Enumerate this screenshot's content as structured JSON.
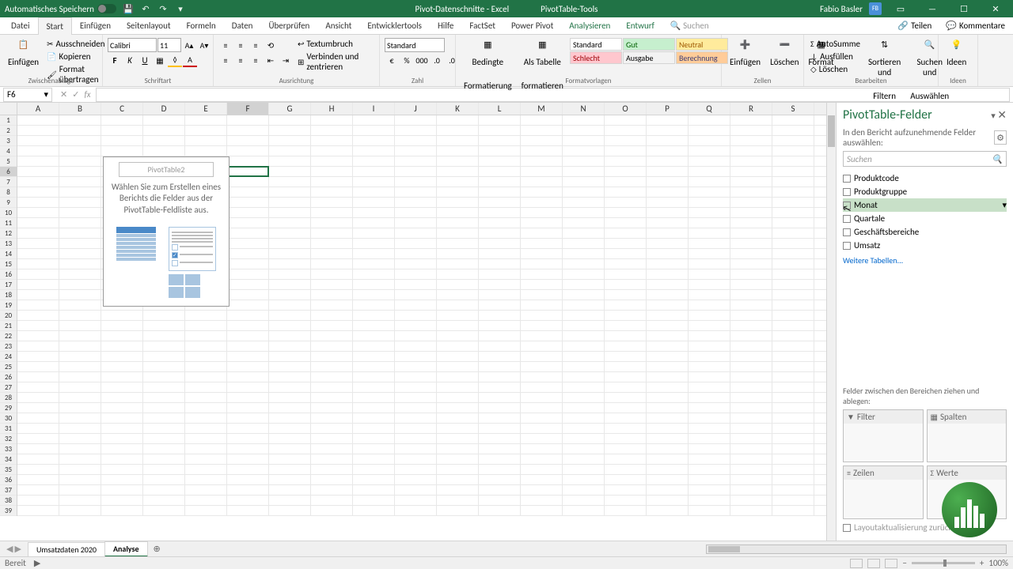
{
  "titlebar": {
    "autosave": "Automatisches Speichern",
    "doc_title": "Pivot-Datenschnitte - Excel",
    "tools": "PivotTable-Tools",
    "user": "Fabio Basler",
    "user_initials": "FB"
  },
  "tabs": {
    "datei": "Datei",
    "start": "Start",
    "einf": "Einfügen",
    "seiten": "Seitenlayout",
    "formeln": "Formeln",
    "daten": "Daten",
    "ueber": "Überprüfen",
    "ansicht": "Ansicht",
    "entw": "Entwicklertools",
    "hilfe": "Hilfe",
    "factset": "FactSet",
    "pp": "Power Pivot",
    "anal": "Analysieren",
    "entwurf": "Entwurf",
    "suchen": "Suchen",
    "teilen": "Teilen",
    "komm": "Kommentare"
  },
  "ribbon": {
    "clipboard": {
      "paste": "Einfügen",
      "cut": "Ausschneiden",
      "copy": "Kopieren",
      "format": "Format übertragen",
      "group": "Zwischenablage"
    },
    "font": {
      "name": "Calibri",
      "size": "11",
      "group": "Schriftart"
    },
    "align": {
      "wrap": "Textumbruch",
      "merge": "Verbinden und zentrieren",
      "group": "Ausrichtung"
    },
    "number": {
      "format": "Standard",
      "group": "Zahl"
    },
    "cond": {
      "b1": "Bedingte",
      "b1b": "Formatierung",
      "b2": "Als Tabelle",
      "b2b": "formatieren"
    },
    "styles": {
      "standard": "Standard",
      "gut": "Gut",
      "neutral": "Neutral",
      "schlecht": "Schlecht",
      "ausgabe": "Ausgabe",
      "berechnung": "Berechnung",
      "group": "Formatvorlagen"
    },
    "cells": {
      "ins": "Einfügen",
      "del": "Löschen",
      "fmt": "Format",
      "group": "Zellen"
    },
    "edit": {
      "sum": "AutoSumme",
      "fill": "Ausfüllen",
      "clear": "Löschen",
      "sort": "Sortieren und",
      "sortb": "Filtern",
      "find": "Suchen und",
      "findb": "Auswählen",
      "group": "Bearbeiten"
    },
    "ideas": {
      "btn": "Ideen",
      "group": "Ideen"
    }
  },
  "formula": {
    "cellref": "F6"
  },
  "cols": [
    "A",
    "B",
    "C",
    "D",
    "E",
    "F",
    "G",
    "H",
    "I",
    "J",
    "K",
    "L",
    "M",
    "N",
    "O",
    "P",
    "Q",
    "R",
    "S"
  ],
  "pivot_placeholder": {
    "title": "PivotTable2",
    "line1": "Wählen Sie zum Erstellen eines",
    "line2": "Berichts die Felder aus der",
    "line3": "PivotTable-Feldliste aus."
  },
  "fieldpane": {
    "title": "PivotTable-Felder",
    "sub": "In den Bericht aufzunehmende Felder auswählen:",
    "search": "Suchen",
    "fields": [
      "Produktcode",
      "Produktgruppe",
      "Monat",
      "Quartale",
      "Geschäftsbereiche",
      "Umsatz"
    ],
    "more": "Weitere Tabellen...",
    "drag": "Felder zwischen den Bereichen ziehen und ablegen:",
    "filter": "Filter",
    "cols": "Spalten",
    "rows": "Zeilen",
    "values": "Werte",
    "defer": "Layoutaktualisierung zurückstellen"
  },
  "sheets": {
    "s1": "Umsatzdaten 2020",
    "s2": "Analyse"
  },
  "status": {
    "ready": "Bereit",
    "zoom": "100%"
  }
}
